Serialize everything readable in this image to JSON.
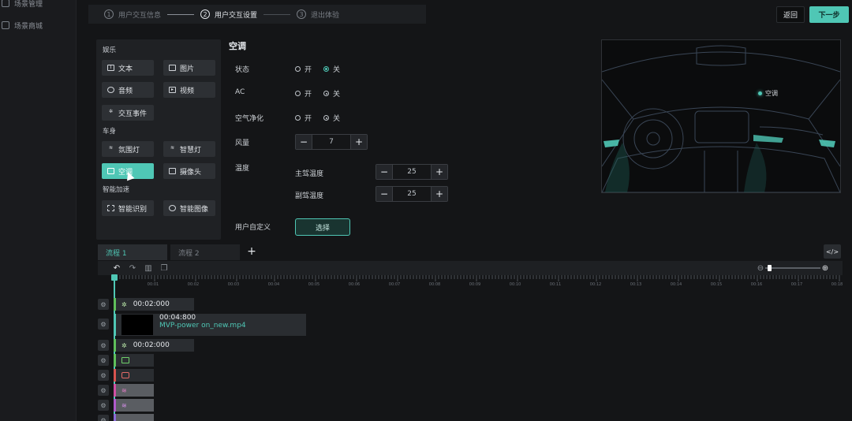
{
  "sidebar": {
    "items": [
      {
        "label": "场景管理"
      },
      {
        "label": "场景商城"
      }
    ]
  },
  "steps": [
    {
      "num": "1",
      "label": "用户交互信息"
    },
    {
      "num": "2",
      "label": "用户交互设置"
    },
    {
      "num": "3",
      "label": "退出体验"
    }
  ],
  "header": {
    "back_label": "返回",
    "next_label": "下一步"
  },
  "palette": {
    "sections": [
      {
        "title": "娱乐",
        "items": [
          "文本",
          "图片",
          "音频",
          "视频",
          "交互事件"
        ]
      },
      {
        "title": "车身",
        "items": [
          "氛围灯",
          "智慧灯",
          "空调",
          "摄像头"
        ]
      },
      {
        "title": "智能加速",
        "items": [
          "智能识别",
          "智能图像"
        ]
      }
    ],
    "selected": "空调"
  },
  "settings": {
    "title": "空调",
    "state_label": "状态",
    "ac_label": "AC",
    "purify_label": "空气净化",
    "wind_label": "风量",
    "temp_label": "温度",
    "driver_temp_label": "主驾温度",
    "passenger_temp_label": "副驾温度",
    "custom_label": "用户自定义",
    "on_label": "开",
    "off_label": "关",
    "wind_value": "7",
    "driver_temp_value": "25",
    "passenger_temp_value": "25",
    "select_label": "选择"
  },
  "preview": {
    "tag": "空调"
  },
  "flows": {
    "tab1": "流程 1",
    "tab2": "流程 2",
    "add": "+",
    "code": "</>"
  },
  "timeline": {
    "ticks": [
      "00:01",
      "00:02",
      "00:03",
      "00:04",
      "00:05",
      "00:06",
      "00:07",
      "00:08",
      "00:09",
      "00:10",
      "00:11",
      "00:12",
      "00:13",
      "00:14",
      "00:15",
      "00:16",
      "00:17",
      "00:18"
    ],
    "clips": [
      {
        "time": "00:02:000"
      },
      {
        "time": "00:04:800",
        "file": "MVP-power on_new.mp4"
      },
      {
        "time": "00:02:000"
      }
    ]
  },
  "colors": {
    "accent": "#4fc7b5",
    "background": "#141517"
  }
}
